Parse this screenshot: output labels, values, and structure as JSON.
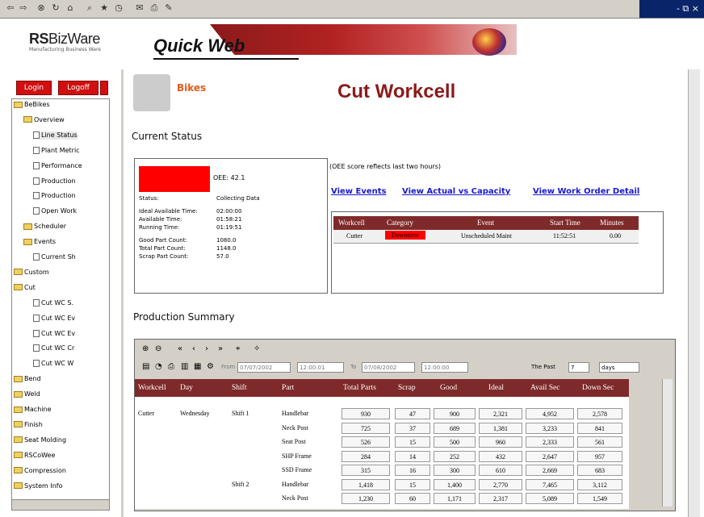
{
  "window": {
    "controls": "- ⧉ ×"
  },
  "toolbar": {
    "icons": [
      "back-icon",
      "forward-icon",
      "stop-icon",
      "refresh-icon",
      "home-icon",
      "search-icon",
      "favorites-icon",
      "history-icon",
      "mail-icon",
      "print-icon",
      "edit-icon"
    ]
  },
  "brand": {
    "rs": "RS",
    "bizware": "BizWare",
    "tagline": "Manufacturing Business Ware",
    "product": "Quick Web"
  },
  "nav": {
    "login_label": "Login",
    "logoff_label": "Logoff",
    "tree": [
      {
        "label": "BeBikes",
        "depth": 0,
        "type": "folder",
        "toggle": "-"
      },
      {
        "label": "Overview",
        "depth": 1,
        "type": "folder",
        "toggle": "-"
      },
      {
        "label": "Line Status",
        "depth": 2,
        "type": "page",
        "selected": true
      },
      {
        "label": "Plant Metric",
        "depth": 2,
        "type": "page"
      },
      {
        "label": "Performance",
        "depth": 2,
        "type": "page"
      },
      {
        "label": "Production",
        "depth": 2,
        "type": "page"
      },
      {
        "label": "Production",
        "depth": 2,
        "type": "page"
      },
      {
        "label": "Open Work",
        "depth": 2,
        "type": "page"
      },
      {
        "label": "Scheduler",
        "depth": 1,
        "type": "folder",
        "toggle": "+"
      },
      {
        "label": "Events",
        "depth": 1,
        "type": "folder",
        "toggle": "+"
      },
      {
        "label": "Current Sh",
        "depth": 2,
        "type": "page"
      },
      {
        "label": "Custom",
        "depth": 0,
        "type": "folder",
        "toggle": "+"
      },
      {
        "label": "Cut",
        "depth": 0,
        "type": "folder",
        "toggle": "-"
      },
      {
        "label": "Cut WC S.",
        "depth": 2,
        "type": "page"
      },
      {
        "label": "Cut WC Ev",
        "depth": 2,
        "type": "page"
      },
      {
        "label": "Cut WC Ev",
        "depth": 2,
        "type": "page"
      },
      {
        "label": "Cut WC Cr",
        "depth": 2,
        "type": "page"
      },
      {
        "label": "Cut WC W",
        "depth": 2,
        "type": "page"
      },
      {
        "label": "Bend",
        "depth": 0,
        "type": "folder",
        "toggle": "+"
      },
      {
        "label": "Weld",
        "depth": 0,
        "type": "folder",
        "toggle": "+"
      },
      {
        "label": "Machine",
        "depth": 0,
        "type": "folder",
        "toggle": "+"
      },
      {
        "label": "Finish",
        "depth": 0,
        "type": "folder",
        "toggle": "+"
      },
      {
        "label": "Seat Molding",
        "depth": 0,
        "type": "folder",
        "toggle": "+"
      },
      {
        "label": "RSCoWee",
        "depth": -1,
        "type": "folder",
        "toggle": "+"
      },
      {
        "label": "Compression",
        "depth": -1,
        "type": "folder",
        "toggle": "+"
      },
      {
        "label": "System Info",
        "depth": -1,
        "type": "folder",
        "toggle": "+"
      }
    ]
  },
  "header": {
    "bikes_label": "Bikes",
    "title": "Cut Workcell"
  },
  "current_status": {
    "heading": "Current Status",
    "oee": "OEE: 42.1",
    "oee_note": "(OEE score reflects last two hours)",
    "rows": [
      {
        "label": "Status:",
        "value": "Collecting Data"
      },
      {
        "label": "Ideal Available Time:",
        "value": "02:00:00"
      },
      {
        "label": "Available Time:",
        "value": "01:58:21"
      },
      {
        "label": "Running Time:",
        "value": "01:19:51"
      },
      {
        "label": "Good Part Count:",
        "value": "1080.0"
      },
      {
        "label": "Total Part Count:",
        "value": "1148.0"
      },
      {
        "label": "Scrap Part Count:",
        "value": "57.0"
      }
    ],
    "colors": {
      "oee_bar": "#ff0000"
    }
  },
  "links": {
    "view_events": "View Events",
    "view_actual": "View Actual vs Capacity",
    "view_work_order": "View Work Order Detail"
  },
  "events_table": {
    "headers": [
      "Workcell",
      "Category",
      "Event",
      "Start Time",
      "Minutes"
    ],
    "rows": [
      [
        "Cutter",
        "Downtime",
        "Unscheduled Maint",
        "11:52:51",
        "0.00"
      ]
    ]
  },
  "production_summary": {
    "heading": "Production Summary",
    "toolbar": {
      "from_label": "From",
      "to_label": "To",
      "from_date": "07/07/2002",
      "from_time": "12:00:01",
      "to_date": "07/08/2002",
      "to_time": "12:00:00",
      "the_past_label": "The Past",
      "past_value": "7",
      "unit_value": "days"
    },
    "headers": [
      "Workcell",
      "Day",
      "Shift",
      "Part",
      "Total Parts",
      "Scrap",
      "Good",
      "Ideal",
      "Avail Sec",
      "Down Sec"
    ],
    "rows": [
      {
        "workcell": "Cutter",
        "day": "Wednesday",
        "shift": "Shift 1",
        "part": "Handlebar",
        "total": "930",
        "scrap": "47",
        "good": "900",
        "ideal": "2,321",
        "avail": "4,952",
        "down": "2,578"
      },
      {
        "workcell": "",
        "day": "",
        "shift": "",
        "part": "Neck Post",
        "total": "725",
        "scrap": "37",
        "good": "689",
        "ideal": "1,381",
        "avail": "3,233",
        "down": "841"
      },
      {
        "workcell": "",
        "day": "",
        "shift": "",
        "part": "Seat Post",
        "total": "526",
        "scrap": "15",
        "good": "500",
        "ideal": "960",
        "avail": "2,333",
        "down": "561"
      },
      {
        "workcell": "",
        "day": "",
        "shift": "",
        "part": "SHP Frame",
        "total": "284",
        "scrap": "14",
        "good": "252",
        "ideal": "432",
        "avail": "2,647",
        "down": "957"
      },
      {
        "workcell": "",
        "day": "",
        "shift": "",
        "part": "SSD Frame",
        "total": "315",
        "scrap": "16",
        "good": "300",
        "ideal": "610",
        "avail": "2,669",
        "down": "683"
      },
      {
        "workcell": "",
        "day": "",
        "shift": "Shift 2",
        "part": "Handlebar",
        "total": "1,418",
        "scrap": "15",
        "good": "1,400",
        "ideal": "2,770",
        "avail": "7,465",
        "down": "3,112"
      },
      {
        "workcell": "",
        "day": "",
        "shift": "",
        "part": "Neck Post",
        "total": "1,230",
        "scrap": "60",
        "good": "1,171",
        "ideal": "2,317",
        "avail": "5,089",
        "down": "1,549"
      }
    ]
  }
}
